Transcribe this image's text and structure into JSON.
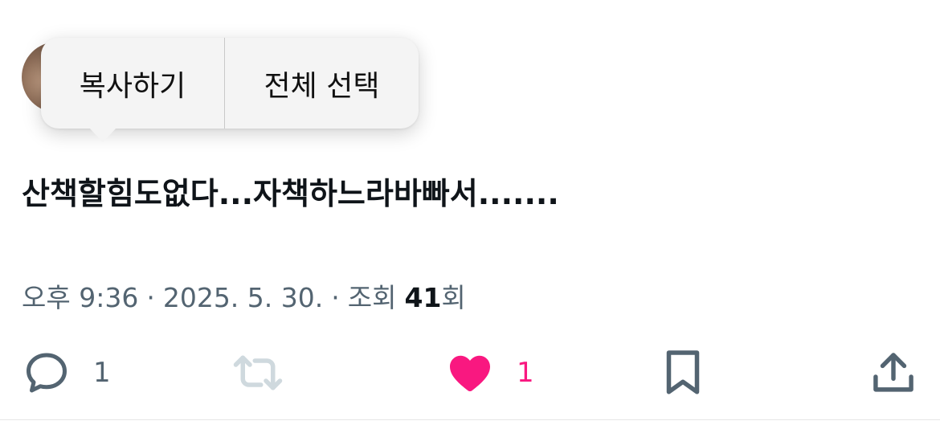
{
  "context_menu": {
    "copy_label": "복사하기",
    "select_all_label": "전체 선택"
  },
  "tweet": {
    "text": "산책할힘도없다...자책하느라바빠서.......",
    "time": "오후 9:36",
    "date": "2025. 5. 30.",
    "separator": "·",
    "views_label": "조회",
    "views_count": "41",
    "views_suffix": "회"
  },
  "actions": {
    "reply_count": "1",
    "like_count": "1"
  },
  "icons": {
    "reply": "speech-bubble-icon",
    "retweet": "retweet-icon",
    "like": "heart-icon",
    "bookmark": "bookmark-icon",
    "share": "share-upload-icon"
  },
  "colors": {
    "like_active": "#f91880",
    "muted_gray": "#536471",
    "retweet_disabled": "#cfd9de",
    "text_primary": "#0f1419"
  }
}
